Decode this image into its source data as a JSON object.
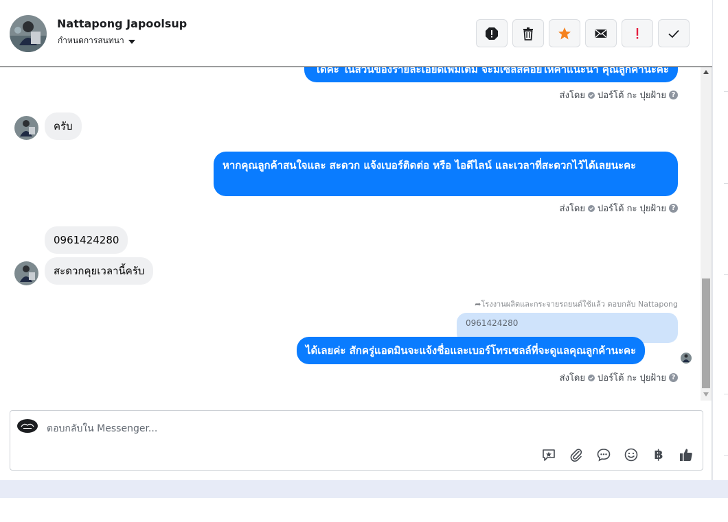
{
  "header": {
    "contact_name": "Nattapong Japoolsup",
    "assign_label": "กำหนดการสนทนา",
    "actions": [
      {
        "name": "spam-button",
        "icon": "alert-octagon-icon"
      },
      {
        "name": "delete-button",
        "icon": "trash-icon"
      },
      {
        "name": "star-button",
        "icon": "star-icon"
      },
      {
        "name": "mark-unread-button",
        "icon": "envelope-icon"
      },
      {
        "name": "follow-up-button",
        "icon": "exclamation-icon"
      },
      {
        "name": "done-button",
        "icon": "check-icon"
      }
    ],
    "colors": {
      "star": "#f5821f",
      "follow_up": "#e41e3f"
    }
  },
  "messages": {
    "m1_text": "ได้ค่ะ  ในส่วนของรายละเอียดเพิ่มเติม จะมีเซลส์คอยให้คำแนะนำ คุณลูกค้านะคะ",
    "m2_text": "ครับ",
    "m3_text": "หากคุณลูกค้าสนใจและ สะดวก แจ้งเบอร์ติดต่อ หรือ ไอดีไลน์ และเวลาที่สะดวกไว้ได้เลยนะคะ",
    "m4_text": "0961424280",
    "m5_text": "สะดวกคุยเวลานี้ครับ",
    "reply_meta": "โรงงานผลิตและกระจายรถยนต์ใช้แล้ว ตอบกลับ Nattapong",
    "quoted_text": "0961424280",
    "m6_text": "ได้เลยค่ะ สักครู่แอดมินจะแจ้งชื่อและเบอร์โทรเซลล์ที่จะดูแลคุณลูกค้านะคะ",
    "sent_by_label": "ส่งโดย",
    "sender_name": "ปอร์โต้ กะ ปุยฝ้าย",
    "outgoing_color": "#0a7cff"
  },
  "composer": {
    "placeholder": "ตอบกลับใน Messenger...",
    "tools": [
      "saved-reply-icon",
      "paperclip-icon",
      "chat-bubble-icon",
      "emoji-icon",
      "baht-icon",
      "thumbs-up-icon"
    ],
    "baht_symbol": "฿"
  }
}
